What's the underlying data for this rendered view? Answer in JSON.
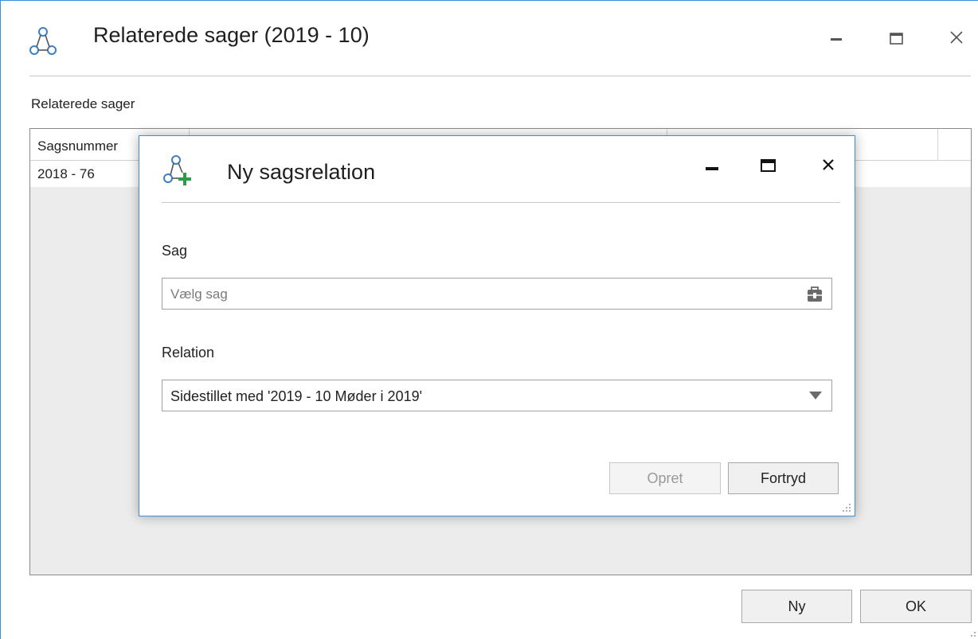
{
  "outer_window": {
    "title": "Relaterede sager (2019 - 10)",
    "section_label": "Relaterede sager",
    "grid": {
      "columns": [
        "Sagsnummer",
        "",
        "",
        ""
      ],
      "rows": [
        [
          "2018 - 76",
          "",
          "",
          ""
        ]
      ]
    },
    "buttons": {
      "new_label": "Ny",
      "ok_label": "OK"
    }
  },
  "modal": {
    "title": "Ny sagsrelation",
    "case_field": {
      "label": "Sag",
      "placeholder": "Vælg sag",
      "icon": "case-picker-icon"
    },
    "relation_field": {
      "label": "Relation",
      "selected": "Sidestillet med '2019 - 10 Møder i 2019'"
    },
    "buttons": {
      "create_label": "Opret",
      "cancel_label": "Fortryd"
    }
  },
  "colors": {
    "window_border": "#3c8fd6",
    "accent_green": "#2e9b4a",
    "icon_blue": "#3c7fc4"
  }
}
